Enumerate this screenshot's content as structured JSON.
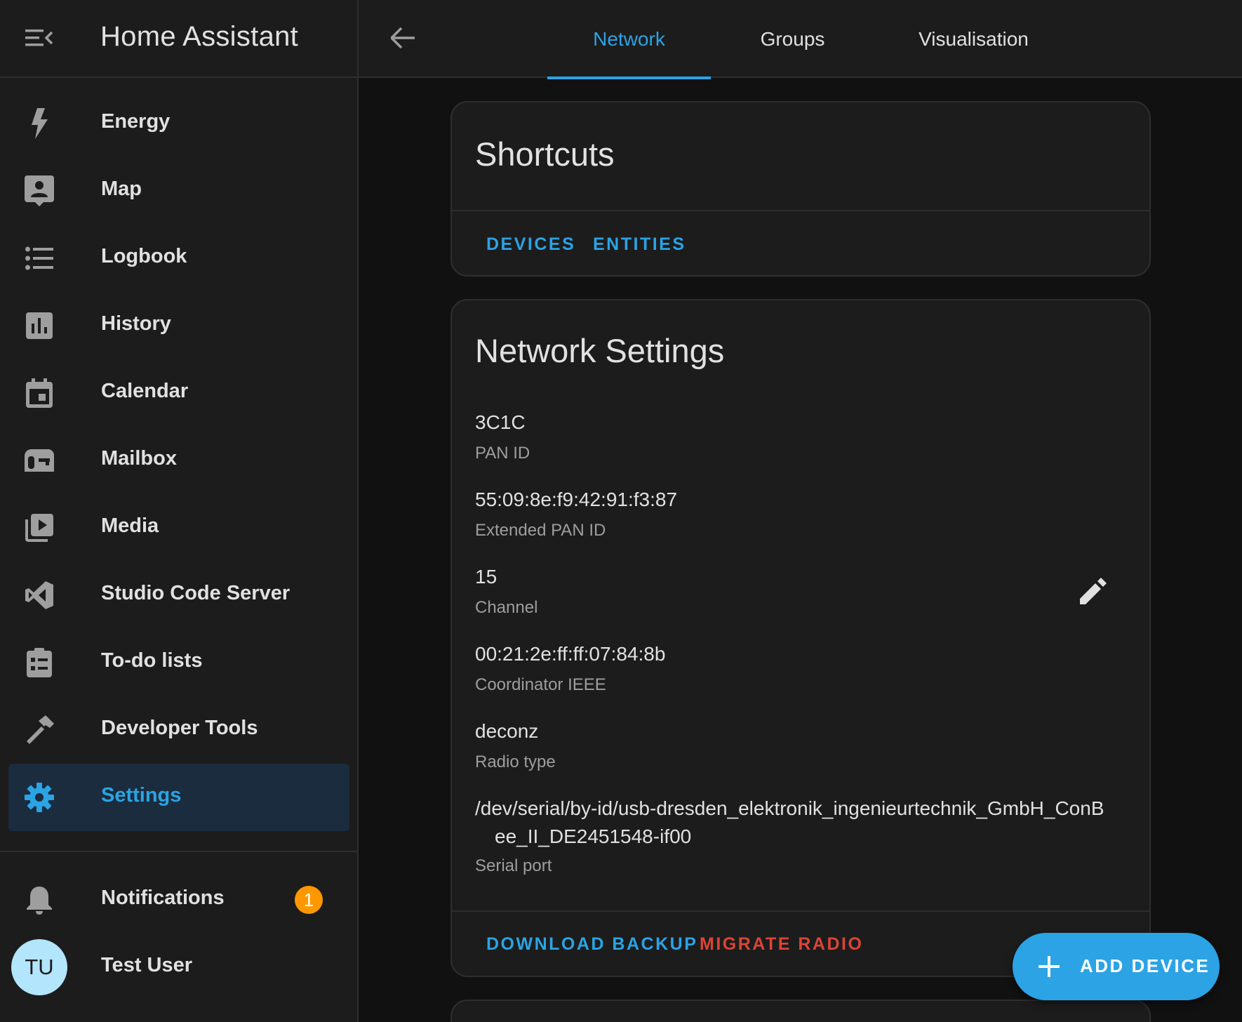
{
  "app": {
    "title": "Home Assistant"
  },
  "sidebar": {
    "items": [
      {
        "label": "Energy",
        "icon": "lightning-bolt-icon"
      },
      {
        "label": "Map",
        "icon": "account-box-icon"
      },
      {
        "label": "Logbook",
        "icon": "format-list-bulleted-icon"
      },
      {
        "label": "History",
        "icon": "chart-box-icon"
      },
      {
        "label": "Calendar",
        "icon": "calendar-icon"
      },
      {
        "label": "Mailbox",
        "icon": "mailbox-icon"
      },
      {
        "label": "Media",
        "icon": "play-box-multiple-icon"
      },
      {
        "label": "Studio Code Server",
        "icon": "code-server-icon"
      },
      {
        "label": "To-do lists",
        "icon": "clipboard-list-icon"
      },
      {
        "label": "Developer Tools",
        "icon": "hammer-icon"
      },
      {
        "label": "Settings",
        "icon": "cog-icon",
        "active": true
      }
    ],
    "notifications": {
      "label": "Notifications",
      "count": "1"
    },
    "user": {
      "label": "Test User",
      "initials": "TU"
    }
  },
  "topbar": {
    "tabs": [
      {
        "label": "Network",
        "active": true
      },
      {
        "label": "Groups"
      },
      {
        "label": "Visualisation"
      }
    ]
  },
  "shortcuts": {
    "title": "Shortcuts",
    "devices_label": "DEVICES",
    "entities_label": "ENTITIES"
  },
  "network": {
    "title": "Network Settings",
    "fields": [
      {
        "value": "3C1C",
        "label": "PAN ID"
      },
      {
        "value": "55:09:8e:f9:42:91:f3:87",
        "label": "Extended PAN ID"
      },
      {
        "value": "15",
        "label": "Channel"
      },
      {
        "value": "00:21:2e:ff:ff:07:84:8b",
        "label": "Coordinator IEEE"
      },
      {
        "value": "deconz",
        "label": "Radio type"
      },
      {
        "value_line1": "/dev/serial/by-id/usb-dresden_elektronik_ingenieurtechnik_GmbH_ConB",
        "value_line2": "ee_II_DE2451548-if00",
        "label": "Serial port"
      }
    ],
    "download_backup_label": "DOWNLOAD BACKUP",
    "migrate_radio_label": "MIGRATE RADIO"
  },
  "fab": {
    "label": "ADD DEVICE"
  },
  "colors": {
    "accent": "#2ba3e5",
    "danger": "#db4437",
    "badge": "#ff9800",
    "sidebar_bg": "#1c1c1c",
    "page_bg": "#111111"
  }
}
